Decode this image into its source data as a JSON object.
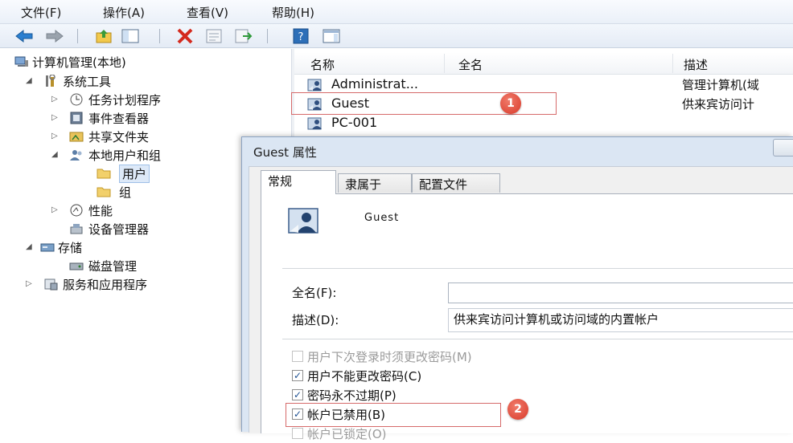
{
  "menu": [
    "文件(F)",
    "操作(A)",
    "查看(V)",
    "帮助(H)"
  ],
  "toolbar_icons": [
    "back-arrow-icon",
    "forward-arrow-icon",
    "up-folder-icon",
    "show-hide-tree-icon",
    "delete-icon",
    "properties-icon",
    "export-list-icon",
    "help-icon",
    "console-view-icon"
  ],
  "tree": {
    "root": "计算机管理(本地)",
    "system_tools": "系统工具",
    "task_scheduler": "任务计划程序",
    "event_viewer": "事件查看器",
    "shared_folders": "共享文件夹",
    "local_users_groups": "本地用户和组",
    "users": "用户",
    "groups": "组",
    "performance": "性能",
    "device_manager": "设备管理器",
    "storage": "存储",
    "disk_management": "磁盘管理",
    "services_apps": "服务和应用程序"
  },
  "list": {
    "columns": [
      "名称",
      "全名",
      "描述"
    ],
    "rows": [
      {
        "name": "Administrat...",
        "desc": "管理计算机(域"
      },
      {
        "name": "Guest",
        "desc": "供来宾访问计"
      },
      {
        "name": "PC-001",
        "desc": ""
      }
    ]
  },
  "markers": [
    "1",
    "2"
  ],
  "dialog": {
    "title": "Guest 属性",
    "tabs": [
      "常规",
      "隶属于",
      "配置文件"
    ],
    "username": "Guest",
    "fullname_label": "全名(F):",
    "fullname_value": "",
    "description_label": "描述(D):",
    "description_value": "供来宾访问计算机或访问域的内置帐户",
    "checkboxes": [
      {
        "label": "用户下次登录时须更改密码(M)",
        "checked": false,
        "enabled": false
      },
      {
        "label": "用户不能更改密码(C)",
        "checked": true,
        "enabled": true
      },
      {
        "label": "密码永不过期(P)",
        "checked": true,
        "enabled": true
      },
      {
        "label": "帐户已禁用(B)",
        "checked": true,
        "enabled": true
      },
      {
        "label": "帐户已锁定(O)",
        "checked": false,
        "enabled": false
      }
    ]
  },
  "colors": {
    "accent": "#1d4f91",
    "highlight_box": "#d66a6a",
    "marker": "#d93a2a"
  }
}
